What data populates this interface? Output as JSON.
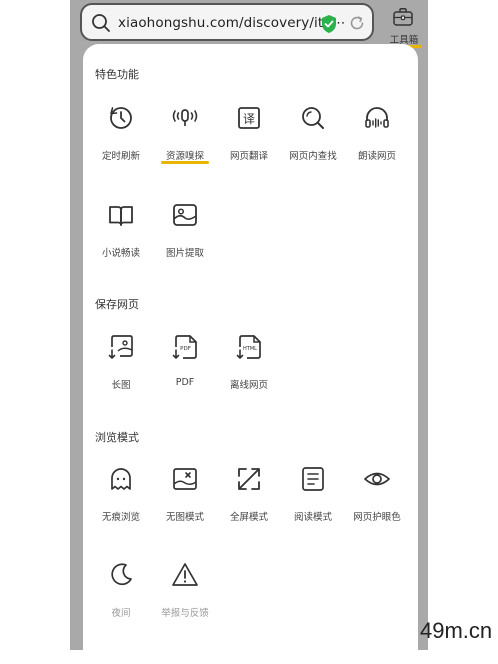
{
  "urlbar": {
    "url": "xiaohongshu.com/discovery/ite⋯"
  },
  "toolbox": {
    "label": "工具箱"
  },
  "sections": [
    {
      "title": "特色功能"
    },
    {
      "title": "保存网页"
    },
    {
      "title": "浏览模式"
    }
  ],
  "features": {
    "timed_refresh": "定时刷新",
    "resource_sniff": "资源嗅探",
    "page_translate": "网页翻译",
    "page_search": "网页内查找",
    "read_aloud": "朗读网页",
    "novel_reading": "小说畅读",
    "image_extract": "图片提取"
  },
  "save": {
    "long_image": "长图",
    "pdf": "PDF",
    "offline_page": "离线网页",
    "pdf_icon_text": "PDF",
    "html_icon_text": "HTML"
  },
  "browse": {
    "incognito": "无痕浏览",
    "no_image": "无图模式",
    "fullscreen": "全屏模式",
    "reader_mode": "阅读模式",
    "eye_care": "网页护眼色",
    "night": "夜间",
    "report": "举报与反馈"
  },
  "watermark": "49m.cn",
  "colors": {
    "accent_underline": "#e8b400",
    "shield_green": "#2bb24c"
  }
}
